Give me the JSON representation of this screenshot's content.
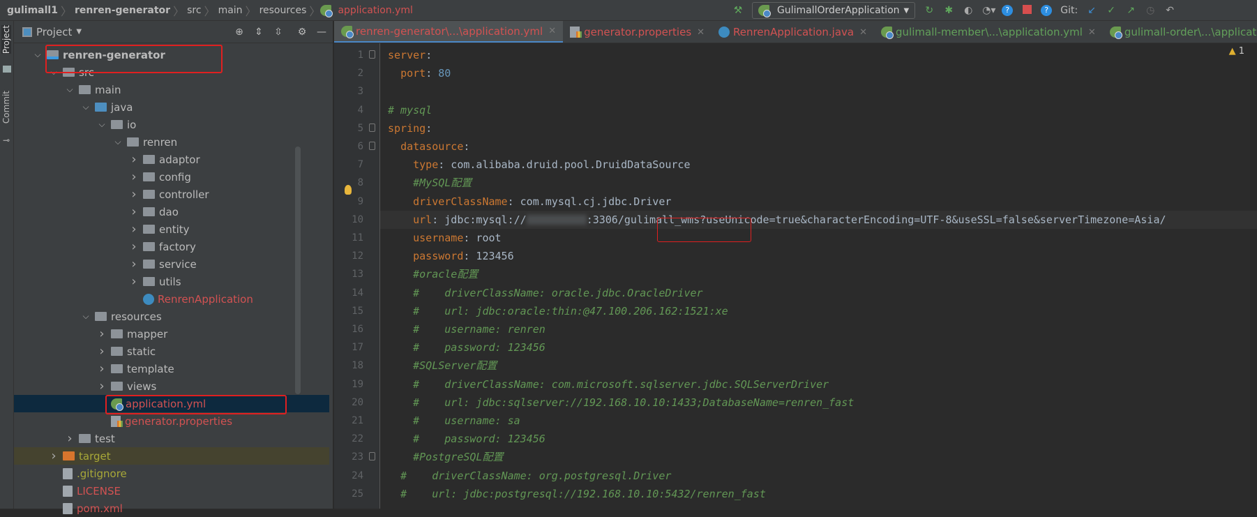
{
  "breadcrumb": [
    "gulimall1",
    "renren-generator",
    "src",
    "main",
    "resources",
    "application.yml"
  ],
  "toolbar": {
    "run_config": "GulimallOrderApplication",
    "git_label": "Git:"
  },
  "stripe": {
    "project": "Project",
    "commit": "Commit"
  },
  "panel": {
    "title": "Project"
  },
  "tree": [
    {
      "label": "renren-generator",
      "level": 0,
      "type": "module",
      "open": true,
      "bold": true
    },
    {
      "label": "src",
      "level": 1,
      "type": "folder",
      "open": true
    },
    {
      "label": "main",
      "level": 2,
      "type": "folder",
      "open": true
    },
    {
      "label": "java",
      "level": 3,
      "type": "folder-blue",
      "open": true
    },
    {
      "label": "io",
      "level": 4,
      "type": "folder",
      "open": true
    },
    {
      "label": "renren",
      "level": 5,
      "type": "folder",
      "open": true
    },
    {
      "label": "adaptor",
      "level": 6,
      "type": "folder",
      "open": false
    },
    {
      "label": "config",
      "level": 6,
      "type": "folder",
      "open": false
    },
    {
      "label": "controller",
      "level": 6,
      "type": "folder",
      "open": false
    },
    {
      "label": "dao",
      "level": 6,
      "type": "folder",
      "open": false
    },
    {
      "label": "entity",
      "level": 6,
      "type": "folder",
      "open": false
    },
    {
      "label": "factory",
      "level": 6,
      "type": "folder",
      "open": false
    },
    {
      "label": "service",
      "level": 6,
      "type": "folder",
      "open": false
    },
    {
      "label": "utils",
      "level": 6,
      "type": "folder",
      "open": false
    },
    {
      "label": "RenrenApplication",
      "level": 6,
      "type": "java",
      "color": "#d25252"
    },
    {
      "label": "resources",
      "level": 3,
      "type": "folder",
      "open": true
    },
    {
      "label": "mapper",
      "level": 4,
      "type": "folder",
      "open": false
    },
    {
      "label": "static",
      "level": 4,
      "type": "folder",
      "open": false
    },
    {
      "label": "template",
      "level": 4,
      "type": "folder",
      "open": false
    },
    {
      "label": "views",
      "level": 4,
      "type": "folder",
      "open": false
    },
    {
      "label": "application.yml",
      "level": 4,
      "type": "spring",
      "color": "#d25252",
      "selected": true
    },
    {
      "label": "generator.properties",
      "level": 4,
      "type": "props",
      "color": "#d25252"
    },
    {
      "label": "test",
      "level": 2,
      "type": "folder",
      "open": false
    },
    {
      "label": "target",
      "level": 1,
      "type": "folder-orange",
      "open": false,
      "color": "#a8a838",
      "highlight": true
    },
    {
      "label": ".gitignore",
      "level": 1,
      "type": "file",
      "color": "#a8a838"
    },
    {
      "label": "LICENSE",
      "level": 1,
      "type": "file",
      "color": "#d25252"
    },
    {
      "label": "pom.xml",
      "level": 1,
      "type": "file",
      "color": "#d25252"
    }
  ],
  "tabs": [
    {
      "label": "renren-generator\\...\\application.yml",
      "icon": "spring",
      "color": "r",
      "active": true
    },
    {
      "label": "generator.properties",
      "icon": "props",
      "color": "r"
    },
    {
      "label": "RenrenApplication.java",
      "icon": "java",
      "color": "r"
    },
    {
      "label": "gulimall-member\\...\\application.yml",
      "icon": "spring",
      "color": "g"
    },
    {
      "label": "gulimall-order\\...\\application.yml",
      "icon": "spring",
      "color": "g"
    }
  ],
  "inspections": {
    "warnings": "1"
  },
  "code": [
    [
      [
        "k",
        "server"
      ],
      [
        "v",
        ":"
      ]
    ],
    [
      [
        "v",
        "  "
      ],
      [
        "k",
        "port"
      ],
      [
        "v",
        ": "
      ],
      [
        "n",
        "80"
      ]
    ],
    [],
    [
      [
        "c",
        "# mysql"
      ]
    ],
    [
      [
        "k",
        "spring"
      ],
      [
        "v",
        ":"
      ]
    ],
    [
      [
        "v",
        "  "
      ],
      [
        "k",
        "datasource"
      ],
      [
        "v",
        ":"
      ]
    ],
    [
      [
        "v",
        "    "
      ],
      [
        "k",
        "type"
      ],
      [
        "v",
        ": com.alibaba.druid.pool.DruidDataSource"
      ]
    ],
    [
      [
        "v",
        "    "
      ],
      [
        "c",
        "#MySQL配置"
      ]
    ],
    [
      [
        "v",
        "    "
      ],
      [
        "k",
        "driverClassName"
      ],
      [
        "v",
        ": com.mysql.cj.jdbc.Driver"
      ]
    ],
    [
      [
        "v",
        "    "
      ],
      [
        "k",
        "url"
      ],
      [
        "v",
        ": jdbc:mysql://"
      ],
      [
        "blur",
        ""
      ],
      [
        "v",
        ":3306/gulimall_wms?useUnicode=true&characterEncoding=UTF-8&useSSL=false&serverTimezone=Asia/"
      ]
    ],
    [
      [
        "v",
        "    "
      ],
      [
        "k",
        "username"
      ],
      [
        "v",
        ": root"
      ]
    ],
    [
      [
        "v",
        "    "
      ],
      [
        "k",
        "password"
      ],
      [
        "v",
        ": 123456"
      ]
    ],
    [
      [
        "v",
        "    "
      ],
      [
        "c",
        "#oracle配置"
      ]
    ],
    [
      [
        "v",
        "    "
      ],
      [
        "c",
        "#    driverClassName: oracle.jdbc.OracleDriver"
      ]
    ],
    [
      [
        "v",
        "    "
      ],
      [
        "c",
        "#    url: jdbc:oracle:thin:@47.100.206.162:1521:xe"
      ]
    ],
    [
      [
        "v",
        "    "
      ],
      [
        "c",
        "#    username: renren"
      ]
    ],
    [
      [
        "v",
        "    "
      ],
      [
        "c",
        "#    password: 123456"
      ]
    ],
    [
      [
        "v",
        "    "
      ],
      [
        "c",
        "#SQLServer配置"
      ]
    ],
    [
      [
        "v",
        "    "
      ],
      [
        "c",
        "#    driverClassName: com.microsoft.sqlserver.jdbc.SQLServerDriver"
      ]
    ],
    [
      [
        "v",
        "    "
      ],
      [
        "c",
        "#    url: jdbc:sqlserver://192.168.10.10:1433;DatabaseName=renren_fast"
      ]
    ],
    [
      [
        "v",
        "    "
      ],
      [
        "c",
        "#    username: sa"
      ]
    ],
    [
      [
        "v",
        "    "
      ],
      [
        "c",
        "#    password: 123456"
      ]
    ],
    [
      [
        "v",
        "    "
      ],
      [
        "c",
        "#PostgreSQL配置"
      ]
    ],
    [
      [
        "v",
        "  "
      ],
      [
        "c",
        "#    driverClassName: org.postgresql.Driver"
      ]
    ],
    [
      [
        "v",
        "  "
      ],
      [
        "c",
        "#    url: jdbc:postgresql://192.168.10.10:5432/renren_fast"
      ]
    ]
  ],
  "current_line": 10,
  "colors": {
    "accent": "#4a88c7",
    "highlight_box": "#e02020",
    "keyword": "#cc7832",
    "comment": "#629755"
  }
}
